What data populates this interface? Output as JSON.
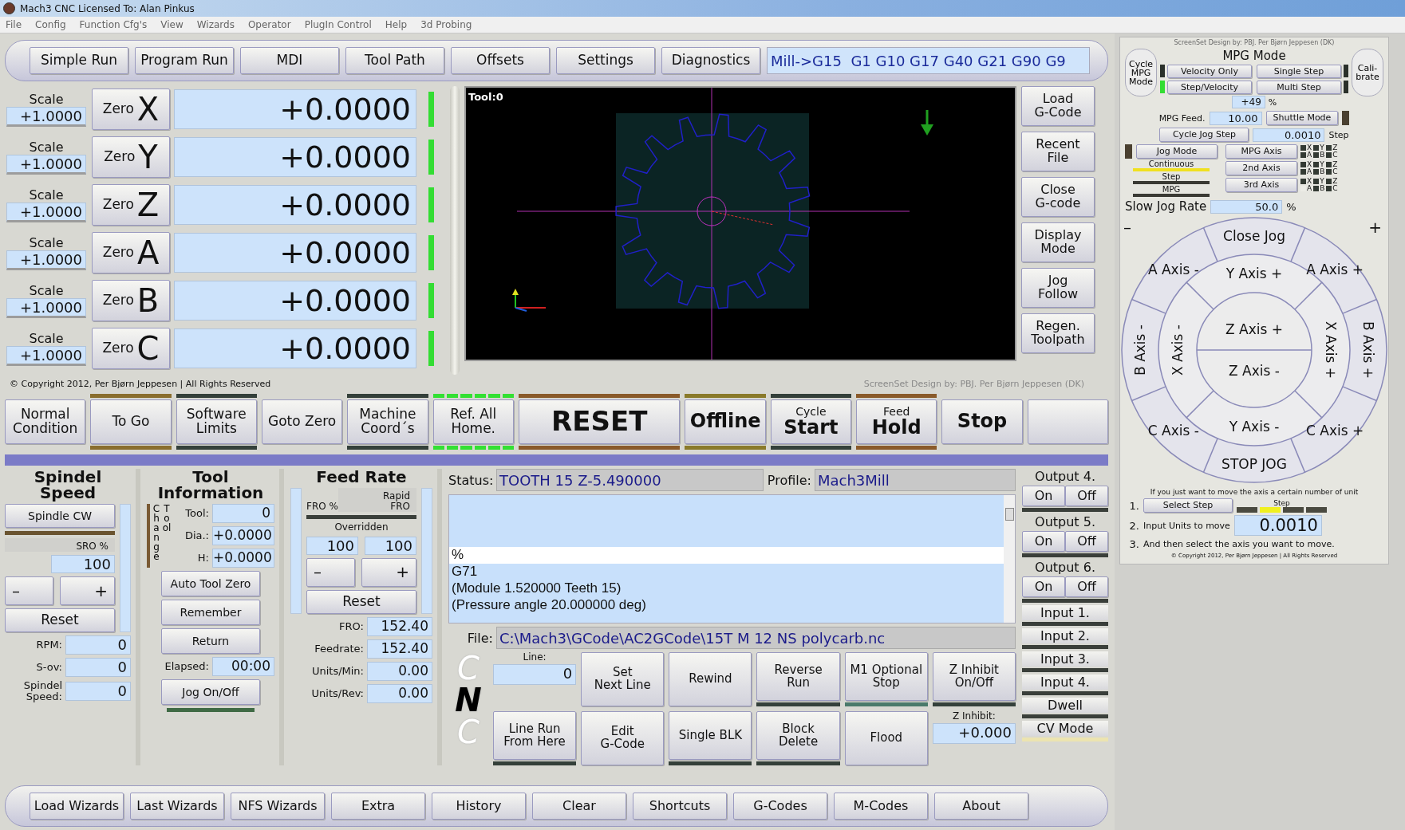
{
  "window": {
    "title": "Mach3 CNC  Licensed To: Alan Pinkus"
  },
  "menu": [
    "File",
    "Config",
    "Function Cfg's",
    "View",
    "Wizards",
    "Operator",
    "PlugIn Control",
    "Help",
    "3d Probing"
  ],
  "tabs": [
    "Simple Run",
    "Program Run",
    "MDI",
    "Tool Path",
    "Offsets",
    "Settings",
    "Diagnostics"
  ],
  "modal_line": "Mill->G15  G1 G10 G17 G40 G21 G90 G9",
  "axes": [
    {
      "scale_label": "Scale",
      "scale": "+1.0000",
      "zero_label": "Zero",
      "letter": "X",
      "value": "+0.0000",
      "lit": true
    },
    {
      "scale_label": "Scale",
      "scale": "+1.0000",
      "zero_label": "Zero",
      "letter": "Y",
      "value": "+0.0000",
      "lit": true
    },
    {
      "scale_label": "Scale",
      "scale": "+1.0000",
      "zero_label": "Zero",
      "letter": "Z",
      "value": "+0.0000",
      "lit": true
    },
    {
      "scale_label": "Scale",
      "scale": "+1.0000",
      "zero_label": "Zero",
      "letter": "A",
      "value": "+0.0000",
      "lit": true
    },
    {
      "scale_label": "Scale",
      "scale": "+1.0000",
      "zero_label": "Zero",
      "letter": "B",
      "value": "+0.0000",
      "lit": true
    },
    {
      "scale_label": "Scale",
      "scale": "+1.0000",
      "zero_label": "Zero",
      "letter": "C",
      "value": "+0.0000",
      "lit": true
    }
  ],
  "toolpath": {
    "tool_label": "Tool:0"
  },
  "side_buttons": [
    "Load\nG-Code",
    "Recent\nFile",
    "Close\nG-code",
    "Display\nMode",
    "Jog\nFollow",
    "Regen.\nToolpath"
  ],
  "copyright": "© Copyright 2012, Per Bjørn Jeppesen | All Rights Reserved",
  "design_credit": "ScreenSet Design by:  PBJ. Per Bjørn Jeppesen  (DK)",
  "actions": [
    {
      "kind": "normal",
      "label": "Normal\nCondition"
    },
    {
      "kind": "normal",
      "label": "To Go",
      "color": "#8a6e2e"
    },
    {
      "kind": "normal",
      "label": "Software\nLimits",
      "color": "#34403a"
    },
    {
      "kind": "normal",
      "label": "Goto Zero"
    },
    {
      "kind": "normal",
      "label": "Machine\nCoord´s",
      "color": "#34403a"
    },
    {
      "kind": "segmented",
      "label": "Ref. All\nHome.",
      "color": "#33e033"
    },
    {
      "kind": "huge",
      "label": "RESET",
      "color": "#8a5a2a"
    },
    {
      "kind": "large",
      "label": "Offline",
      "color": "#8a7a2a"
    },
    {
      "kind": "large",
      "caption": "Cycle",
      "label": "Start",
      "color": "#34403a"
    },
    {
      "kind": "large",
      "caption": "Feed",
      "label": "Hold",
      "color": "#8a5a2a"
    },
    {
      "kind": "large",
      "label": "Stop"
    },
    {
      "kind": "blank"
    }
  ],
  "spindle": {
    "title": "Spindel Speed",
    "cw_button": {
      "label": "Spindle CW",
      "color": "#6a5430"
    },
    "sro_label": "SRO %",
    "sro": "100",
    "minus": "–",
    "plus": "+",
    "reset": "Reset",
    "fields": [
      {
        "label": "RPM:",
        "value": "0"
      },
      {
        "label": "S-ov:",
        "value": "0"
      },
      {
        "label": "Spindel\nSpeed:",
        "value": "0"
      }
    ]
  },
  "tool": {
    "title": "Tool Information",
    "change_tool": [
      "Change",
      "Tool"
    ],
    "fields": [
      {
        "label": "Tool:",
        "value": "0"
      },
      {
        "label": "Dia.:",
        "value": "+0.0000"
      },
      {
        "label": "H:",
        "value": "+0.0000"
      }
    ],
    "buttons": [
      "Auto Tool Zero",
      "Remember",
      "Return"
    ],
    "elapsed_label": "Elapsed:",
    "elapsed": "00:00",
    "jog_button": {
      "label": "Jog On/Off",
      "color": "#3f6a45"
    }
  },
  "feed": {
    "title": "Feed Rate",
    "fro_label": "FRO %",
    "rapid_label": "Rapid\nFRO",
    "overridden": "Overridden",
    "fro": "100",
    "rapid": "100",
    "minus": "–",
    "plus": "+",
    "reset": "Reset",
    "fields": [
      {
        "label": "FRO:",
        "value": "152.40"
      },
      {
        "label": "Feedrate:",
        "value": "152.40"
      },
      {
        "label": "Units/Min:",
        "value": "0.00"
      },
      {
        "label": "Units/Rev:",
        "value": "0.00"
      }
    ]
  },
  "program": {
    "status_label": "Status:",
    "status": "TOOTH 15 Z-5.490000",
    "profile_label": "Profile:",
    "profile": "Mach3Mill",
    "gcode": [
      {
        "text": "%",
        "selected": true
      },
      {
        "text": "G71",
        "selected": false
      },
      {
        "text": "(Module 1.520000 Teeth 15)",
        "selected": false
      },
      {
        "text": "(Pressure angle 20.000000 deg)",
        "selected": false
      }
    ],
    "file_label": "File:",
    "file": "C:\\Mach3\\GCode\\AC2GCode\\15T M 12 NS polycarb.nc",
    "logo": [
      "C",
      "N",
      "C"
    ],
    "line_label": "Line:",
    "line": "0",
    "row1": [
      {
        "label": "Set\nNext Line"
      },
      {
        "label": "Rewind"
      },
      {
        "label": "Reverse\nRun",
        "color": "#34403a"
      },
      {
        "label": "M1 Optional\nStop",
        "color": "#4a7a6a"
      },
      {
        "label": "Z Inhibit\nOn/Off",
        "color": "#34403a"
      }
    ],
    "row2": [
      {
        "label": "Line Run\nFrom Here",
        "color": "#34403a"
      },
      {
        "label": "Edit\nG-Code"
      },
      {
        "label": "Single BLK",
        "color": "#34403a"
      },
      {
        "label": "Block\nDelete",
        "color": "#34403a"
      },
      {
        "label": "Flood"
      }
    ],
    "z_inhibit_label": "Z Inhibit:",
    "z_inhibit": "+0.000"
  },
  "io": [
    {
      "kind": "output",
      "label": "Output 4.",
      "on": "On",
      "off": "Off"
    },
    {
      "kind": "output",
      "label": "Output 5.",
      "on": "On",
      "off": "Off"
    },
    {
      "kind": "output",
      "label": "Output 6.",
      "on": "On",
      "off": "Off"
    },
    {
      "kind": "input",
      "label": "Input 1.",
      "lit": false
    },
    {
      "kind": "input",
      "label": "Input 2.",
      "lit": false
    },
    {
      "kind": "input",
      "label": "Input 3.",
      "lit": false
    },
    {
      "kind": "input",
      "label": "Input 4.",
      "lit": false
    },
    {
      "kind": "input",
      "label": "Dwell",
      "lit": false
    },
    {
      "kind": "input",
      "label": "CV Mode",
      "lit": true
    }
  ],
  "bottom_tabs": [
    "Load Wizards",
    "Last Wizards",
    "NFS Wizards",
    "Extra",
    "History",
    "Clear",
    "Shortcuts",
    "G-Codes",
    "M-Codes",
    "About"
  ],
  "mpg": {
    "credit": "ScreenSet Design by:  PBJ. Per Bjørn Jeppesen  (DK)",
    "cycle_button": "Cycle\nMPG\nMode",
    "title": "MPG Mode",
    "calibrate": "Cali-\nbrate",
    "modes": [
      {
        "label": "Velocity Only",
        "on": false
      },
      {
        "label": "Single Step",
        "on": false
      },
      {
        "label": "Step/Velocity",
        "on": true
      },
      {
        "label": "Multi Step",
        "on": false
      }
    ],
    "percent": "+49",
    "percent_unit": "%",
    "feed_label": "MPG Feed.",
    "feed": "10.00",
    "shuttle": "Shuttle Mode",
    "shuttle_on": false,
    "cycle_jog": "Cycle Jog Step",
    "jog_step": "0.0010",
    "step_unit": "Step",
    "jog_mode": "Jog Mode",
    "jog_mode_on": false,
    "jog_types": [
      {
        "label": "Continuous",
        "selected": true
      },
      {
        "label": "Step",
        "selected": false
      },
      {
        "label": "MPG",
        "selected": false
      }
    ],
    "axis_buttons": [
      {
        "label": "MPG Axis",
        "leds": [
          {
            "letter": "X",
            "on": false
          },
          {
            "letter": "Y",
            "on": false
          },
          {
            "letter": "Z",
            "on": false
          },
          {
            "letter": "A",
            "on": false
          },
          {
            "letter": "B",
            "on": false
          },
          {
            "letter": "C",
            "on": false
          }
        ]
      },
      {
        "label": "2nd Axis",
        "leds": [
          {
            "letter": "X",
            "on": false
          },
          {
            "letter": "Y",
            "on": false
          },
          {
            "letter": "Z",
            "on": false
          },
          {
            "letter": "A",
            "on": false
          },
          {
            "letter": "B",
            "on": false
          },
          {
            "letter": "C",
            "on": false
          }
        ]
      },
      {
        "label": "3rd Axis",
        "leds": [
          {
            "letter": "X",
            "on": false
          },
          {
            "letter": "Y",
            "on": false
          },
          {
            "letter": "Z",
            "on": false
          },
          {
            "letter": "A",
            "on": true
          },
          {
            "letter": "B",
            "on": false
          },
          {
            "letter": "C",
            "on": false
          }
        ]
      }
    ],
    "slow_label": "Slow Jog Rate",
    "slow": "50.0",
    "slow_unit": "%",
    "minus": "–",
    "plus": "+",
    "jog": [
      {
        "label": "Close Jog"
      },
      {
        "label": "A Axis -"
      },
      {
        "label": "Y Axis +"
      },
      {
        "label": "A Axis +"
      },
      {
        "label": "B Axis -"
      },
      {
        "label": "X Axis -"
      },
      {
        "label": "Z Axis +"
      },
      {
        "label": "Z Axis -"
      },
      {
        "label": "X Axis +"
      },
      {
        "label": "B Axis +"
      },
      {
        "label": "C Axis -"
      },
      {
        "label": "Y Axis -"
      },
      {
        "label": "C Axis +"
      },
      {
        "label": "STOP JOG"
      }
    ],
    "hint": "If you just want to move the axis a certain number of unit",
    "step1": "1.",
    "select_step": "Select Step",
    "step_label": "Step",
    "steps": [
      {
        "selected": false
      },
      {
        "selected": true
      },
      {
        "selected": false
      },
      {
        "selected": false
      }
    ],
    "step2": "2.",
    "units_label": "Input Units to move",
    "units": "0.0010",
    "step3": "3.",
    "step3_text": "And then select the axis you want to move.",
    "copyright": "© Copyright 2012, Per Bjørn Jeppesen | All Rights Reserved"
  }
}
